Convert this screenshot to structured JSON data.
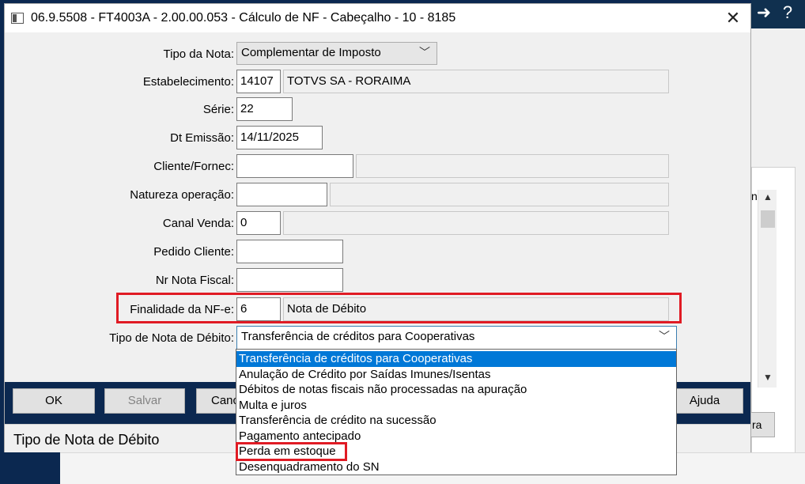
{
  "background": {
    "icons": [
      "exit-icon",
      "help-icon"
    ],
    "fragment_text": "n",
    "button_fragment": "ra",
    "scroll_up": "▲",
    "scroll_down": "▼"
  },
  "dialog": {
    "title": "06.9.5508 - FT4003A - 2.00.00.053 - Cálculo de NF - Cabeçalho - 10 - 8185",
    "close_glyph": "✕"
  },
  "form": {
    "tipo_nota": {
      "label": "Tipo da Nota:",
      "value": "Complementar de Imposto"
    },
    "estabelecimento": {
      "label": "Estabelecimento:",
      "code": "14107",
      "name": "TOTVS SA - RORAIMA"
    },
    "serie": {
      "label": "Série:",
      "value": "22"
    },
    "dt_emissao": {
      "label": "Dt Emissão:",
      "value": "14/11/2025"
    },
    "cliente": {
      "label": "Cliente/Fornec:",
      "code": "",
      "name": ""
    },
    "natureza": {
      "label": "Natureza operação:",
      "code": "",
      "name": ""
    },
    "canal_venda": {
      "label": "Canal Venda:",
      "code": "0",
      "name": ""
    },
    "pedido_cliente": {
      "label": "Pedido Cliente:",
      "value": ""
    },
    "nr_nota": {
      "label": "Nr Nota Fiscal:",
      "value": ""
    },
    "finalidade": {
      "label": "Finalidade da NF-e:",
      "code": "6",
      "name": "Nota de Débito"
    },
    "tipo_debito": {
      "label": "Tipo de Nota de Débito:",
      "value": "Transferência de créditos para Cooperativas"
    }
  },
  "dropdown": {
    "selected_index": 0,
    "options": [
      "Transferência de créditos para Cooperativas",
      "Anulação de Crédito por Saídas Imunes/Isentas",
      "Débitos de notas fiscais não processadas na apuração",
      "Multa e juros",
      "Transferência de crédito na sucessão",
      "Pagamento antecipado",
      "Perda em estoque",
      "Desenquadramento do SN"
    ]
  },
  "buttons": {
    "ok": "OK",
    "salvar": "Salvar",
    "cancelar_partial": "Cance",
    "ajuda": "Ajuda"
  },
  "status": "Tipo de Nota de Débito",
  "colors": {
    "highlight": "#e01b24",
    "selection": "#0078d7",
    "background": "#0b2850"
  }
}
